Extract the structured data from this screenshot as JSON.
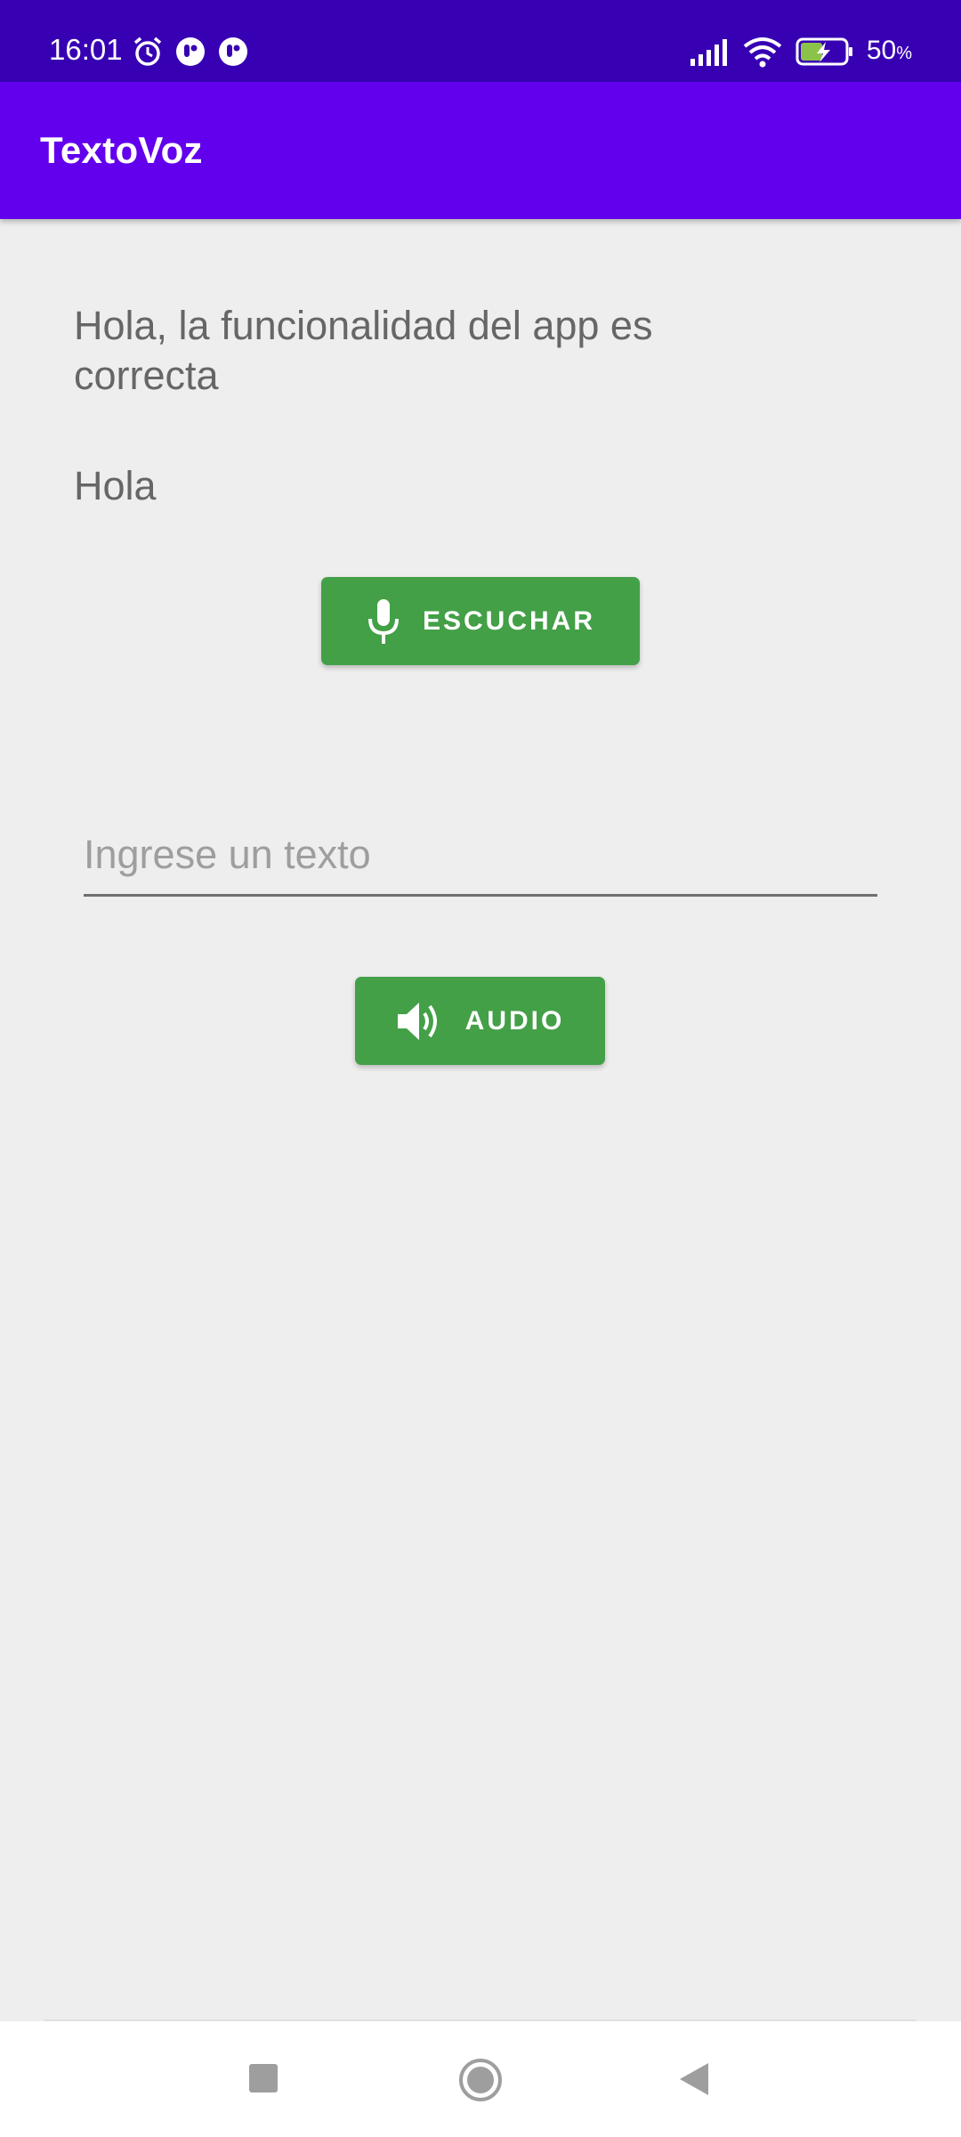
{
  "status_bar": {
    "time": "16:01",
    "left_icons": [
      "alarm-icon",
      "app-notification-icon",
      "app-notification-icon"
    ],
    "right_icons": [
      "signal-icon",
      "wifi-icon",
      "battery-charging-icon"
    ],
    "battery_percent": "50",
    "battery_unit": "%"
  },
  "app_bar": {
    "title": "TextoVoz"
  },
  "main": {
    "recognized_text": "Hola, la funcionalidad del app es correcta",
    "secondary_text": "Hola",
    "listen_button": {
      "label": "ESCUCHAR",
      "icon": "microphone-icon"
    },
    "text_input": {
      "placeholder": "Ingrese un texto",
      "value": ""
    },
    "audio_button": {
      "label": "AUDIO",
      "icon": "speaker-icon"
    }
  },
  "nav_bar": {
    "buttons": [
      "recents",
      "home",
      "back"
    ]
  },
  "colors": {
    "status_bar": "#3700b3",
    "app_bar": "#6200ee",
    "button_green": "#43a047",
    "background": "#eeeeee"
  }
}
